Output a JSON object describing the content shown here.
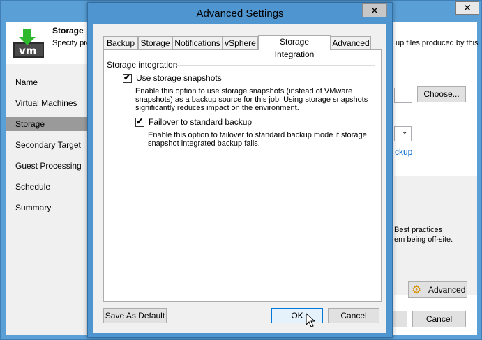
{
  "background_window": {
    "header_title": "Storage",
    "header_desc_left": "Specify pro job and cu",
    "header_desc_right": "up files produced by this",
    "logo_text": "vm",
    "close_glyph": "✕",
    "nav": [
      {
        "label": "Name"
      },
      {
        "label": "Virtual Machines"
      },
      {
        "label": "Storage",
        "active": true
      },
      {
        "label": "Secondary Target"
      },
      {
        "label": "Guest Processing"
      },
      {
        "label": "Schedule"
      },
      {
        "label": "Summary"
      }
    ],
    "choose_label": "Choose...",
    "link_text": "ckup",
    "best_practices_line1": "Best practices",
    "best_practices_line2": "em being off-site.",
    "advanced_label": "Advanced",
    "cancel_label": "Cancel"
  },
  "dialog": {
    "title": "Advanced Settings",
    "close_glyph": "✕",
    "tabs": [
      {
        "label": "Backup"
      },
      {
        "label": "Storage"
      },
      {
        "label": "Notifications"
      },
      {
        "label": "vSphere"
      },
      {
        "label": "Storage Integration",
        "selected": true
      },
      {
        "label": "Advanced"
      }
    ],
    "group_label": "Storage integration",
    "use_snapshots": {
      "label": "Use storage snapshots",
      "checked": true,
      "description": [
        "Enable this option to use storage snapshots (instead of VMware",
        "snapshots) as a backup source for this job. Using storage snapshots",
        "significantly reduces impact on the environment."
      ]
    },
    "failover": {
      "label": "Failover to standard backup",
      "checked": true,
      "description": [
        "Enable this option to failover to standard backup mode if storage",
        "snapshot integrated backup fails."
      ]
    },
    "save_default_label": "Save As Default",
    "ok_label": "OK",
    "cancel_label": "Cancel",
    "check_glyph": "✔"
  },
  "colors": {
    "title_bar": "#4f96d0",
    "accent_link": "#0066cc",
    "primary_button_border": "#0078d7"
  }
}
